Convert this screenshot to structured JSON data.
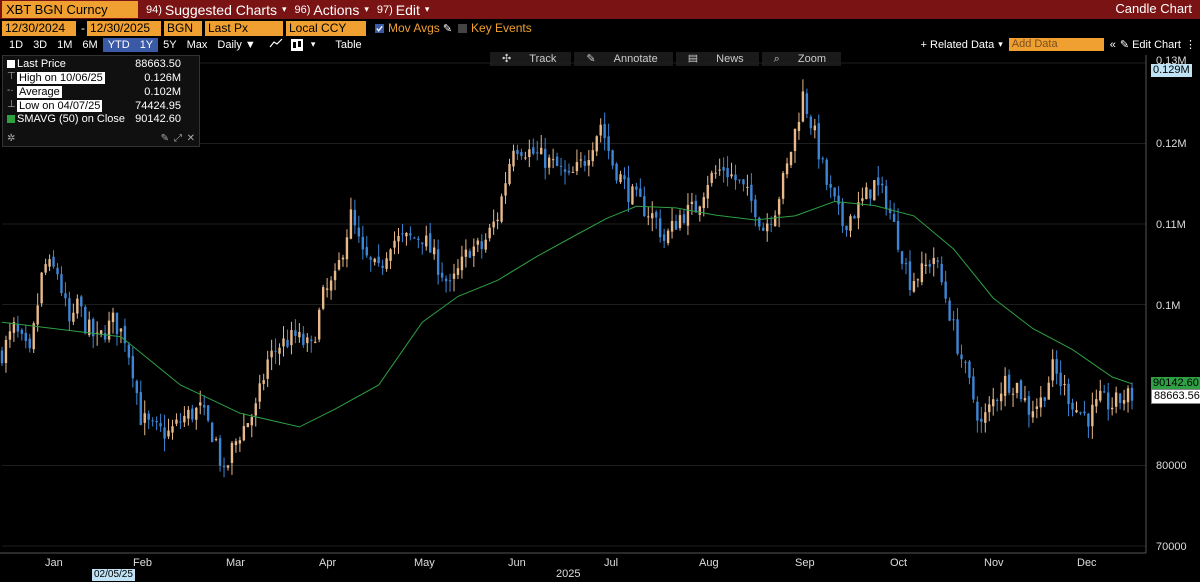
{
  "header": {
    "ticker": "XBT BGN Curncy",
    "suggested": {
      "num": "94)",
      "label": "Suggested Charts"
    },
    "actions": {
      "num": "96)",
      "label": "Actions"
    },
    "edit": {
      "num": "97)",
      "label": "Edit"
    },
    "title": "Candle Chart"
  },
  "controls": {
    "start_date": "12/30/2024",
    "end_date": "12/30/2025",
    "source": "BGN",
    "field": "Last Px",
    "currency": "Local CCY",
    "mov_avgs": "Mov Avgs",
    "key_events": "Key Events",
    "ranges": [
      "1D",
      "3D",
      "1M",
      "6M",
      "YTD",
      "1Y",
      "5Y",
      "Max"
    ],
    "active_ranges": [
      "YTD",
      "1Y"
    ],
    "frequency": "Daily ▼",
    "table": "Table",
    "related_data": "+ Related Data",
    "add_data_placeholder": "Add Data",
    "edit_chart": "Edit Chart"
  },
  "tools": [
    "Track",
    "Annotate",
    "News",
    "Zoom"
  ],
  "legend": {
    "last_price_label": "Last Price",
    "last_price_value": "88663.50",
    "high_label": "High on 10/06/25",
    "high_value": "0.126M",
    "average_label": "Average",
    "average_value": "0.102M",
    "low_label": "Low on 04/07/25",
    "low_value": "74424.95",
    "smavg_label": "SMAVG (50)  on Close",
    "smavg_value": "90142.60"
  },
  "colors": {
    "topbar": "#7a1414",
    "field": "#f0a030",
    "up_candle": "#e8b98a",
    "down_candle": "#3d86d6",
    "sma": "#2ea043",
    "last_tag": "#ffffff",
    "sma_tag": "#2ea043"
  },
  "axis": {
    "months": [
      "Jan",
      "Feb",
      "Mar",
      "Apr",
      "May",
      "Jun",
      "Jul",
      "Aug",
      "Sep",
      "Oct",
      "Nov",
      "Dec"
    ],
    "year": "2025",
    "cursor_date": "02/05/25",
    "y_ticks": [
      "0.13M",
      "0.12M",
      "0.11M",
      "0.1M",
      "80000",
      "70000"
    ],
    "y_tick_values": [
      130000,
      120000,
      110000,
      100000,
      80000,
      70000
    ],
    "top_tag": "0.129M",
    "sma_tag": "90142.60",
    "last_tag": "88663.56"
  },
  "chart_data": {
    "type": "candlestick",
    "x_start": "2024-12-30",
    "x_end": "2025-12-30",
    "ylim": [
      70000,
      131000
    ],
    "close_points": [
      [
        0,
        94000
      ],
      [
        6,
        97000
      ],
      [
        14,
        93500
      ],
      [
        21,
        105000
      ],
      [
        28,
        104000
      ],
      [
        35,
        96500
      ],
      [
        38,
        100500
      ],
      [
        42,
        97500
      ],
      [
        48,
        95500
      ],
      [
        56,
        98000
      ],
      [
        62,
        96000
      ],
      [
        66,
        92000
      ],
      [
        70,
        86000
      ],
      [
        76,
        84500
      ],
      [
        84,
        84000
      ],
      [
        92,
        86000
      ],
      [
        100,
        87000
      ],
      [
        108,
        83000
      ],
      [
        112,
        78500
      ],
      [
        116,
        82000
      ],
      [
        120,
        84000
      ],
      [
        128,
        87000
      ],
      [
        134,
        93000
      ],
      [
        140,
        95000
      ],
      [
        148,
        96000
      ],
      [
        156,
        94500
      ],
      [
        162,
        101000
      ],
      [
        168,
        103000
      ],
      [
        176,
        111000
      ],
      [
        182,
        106000
      ],
      [
        190,
        104000
      ],
      [
        196,
        108000
      ],
      [
        202,
        108000
      ],
      [
        212,
        108500
      ],
      [
        222,
        104000
      ],
      [
        226,
        102000
      ],
      [
        236,
        107000
      ],
      [
        242,
        107000
      ],
      [
        250,
        111000
      ],
      [
        258,
        120000
      ],
      [
        266,
        119000
      ],
      [
        274,
        118000
      ],
      [
        280,
        117000
      ],
      [
        286,
        115500
      ],
      [
        294,
        118000
      ],
      [
        302,
        122500
      ],
      [
        308,
        117500
      ],
      [
        316,
        114000
      ],
      [
        324,
        112000
      ],
      [
        330,
        110500
      ],
      [
        334,
        108000
      ],
      [
        342,
        111000
      ],
      [
        350,
        112000
      ],
      [
        356,
        115500
      ],
      [
        364,
        117000
      ],
      [
        372,
        115000
      ],
      [
        380,
        112000
      ],
      [
        384,
        109500
      ],
      [
        390,
        112000
      ],
      [
        396,
        117000
      ],
      [
        404,
        126000
      ],
      [
        410,
        121000
      ],
      [
        416,
        115000
      ],
      [
        424,
        110000
      ],
      [
        432,
        112000
      ],
      [
        440,
        115000
      ],
      [
        446,
        113000
      ],
      [
        452,
        108000
      ],
      [
        458,
        103000
      ],
      [
        464,
        104000
      ],
      [
        470,
        106000
      ],
      [
        476,
        101000
      ],
      [
        482,
        95000
      ],
      [
        488,
        90000
      ],
      [
        494,
        85000
      ],
      [
        500,
        88000
      ],
      [
        506,
        90500
      ],
      [
        512,
        90000
      ],
      [
        518,
        87000
      ],
      [
        524,
        88000
      ],
      [
        530,
        92000
      ],
      [
        536,
        89500
      ],
      [
        542,
        87000
      ],
      [
        548,
        86000
      ],
      [
        554,
        88000
      ],
      [
        560,
        87500
      ],
      [
        566,
        88500
      ],
      [
        570,
        88663
      ]
    ],
    "sma50_points": [
      [
        0,
        97800
      ],
      [
        30,
        96900
      ],
      [
        60,
        96000
      ],
      [
        90,
        90000
      ],
      [
        120,
        86500
      ],
      [
        150,
        84800
      ],
      [
        168,
        87000
      ],
      [
        190,
        90000
      ],
      [
        212,
        97800
      ],
      [
        230,
        101000
      ],
      [
        250,
        103000
      ],
      [
        270,
        106000
      ],
      [
        290,
        108700
      ],
      [
        305,
        110700
      ],
      [
        320,
        112200
      ],
      [
        340,
        112000
      ],
      [
        360,
        111100
      ],
      [
        380,
        110500
      ],
      [
        400,
        111000
      ],
      [
        420,
        112800
      ],
      [
        440,
        112300
      ],
      [
        460,
        111000
      ],
      [
        480,
        106900
      ],
      [
        500,
        100800
      ],
      [
        520,
        97000
      ],
      [
        540,
        94400
      ],
      [
        560,
        91000
      ],
      [
        570,
        90143
      ]
    ],
    "sma50_last": 90142.6,
    "last_close": 88663.5,
    "high": {
      "date": "10/06/25",
      "value": 126000
    },
    "low": {
      "date": "04/07/25",
      "value": 74424.95
    },
    "average": 102000
  }
}
